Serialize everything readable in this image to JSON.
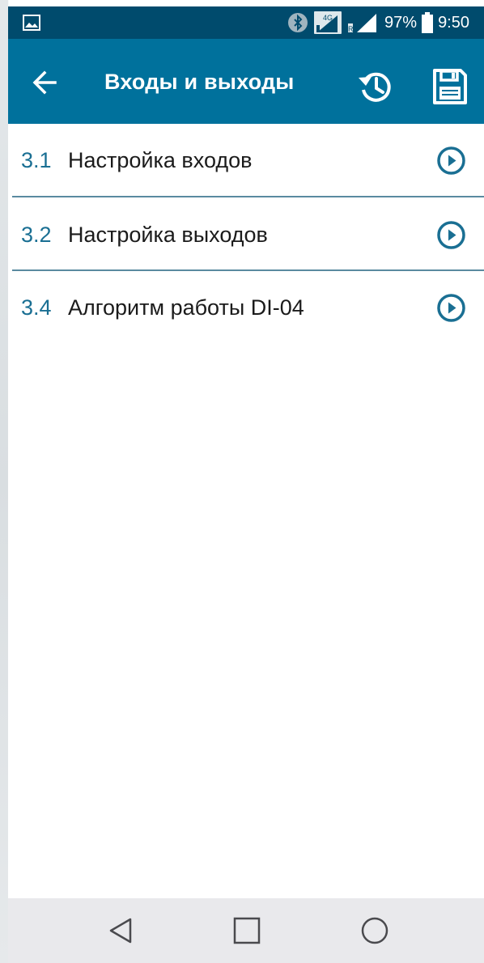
{
  "status_bar": {
    "network_type": "4G",
    "battery": "97%",
    "time": "9:50",
    "icons": [
      "gallery-icon",
      "bluetooth-icon",
      "network-4g-icon",
      "signal-icon",
      "battery-icon"
    ]
  },
  "app_bar": {
    "title": "Входы и выходы",
    "icons": [
      "back-arrow-icon",
      "history-icon",
      "save-icon"
    ]
  },
  "menu": {
    "items": [
      {
        "number": "3.1",
        "label": "Настройка входов",
        "icon": "play-circle-icon"
      },
      {
        "number": "3.2",
        "label": "Настройка выходов",
        "icon": "play-circle-icon"
      },
      {
        "number": "3.4",
        "label": "Алгоритм работы DI-04",
        "icon": "play-circle-icon"
      }
    ]
  },
  "nav_bar": {
    "icons": [
      "back-triangle-icon",
      "recents-square-icon",
      "home-circle-icon"
    ]
  },
  "colors": {
    "status_bar": "#004b6d",
    "app_bar": "#00719c",
    "accent": "#1a6f93",
    "divider": "#5a8aa0",
    "nav_bar": "#e9e9ec"
  }
}
